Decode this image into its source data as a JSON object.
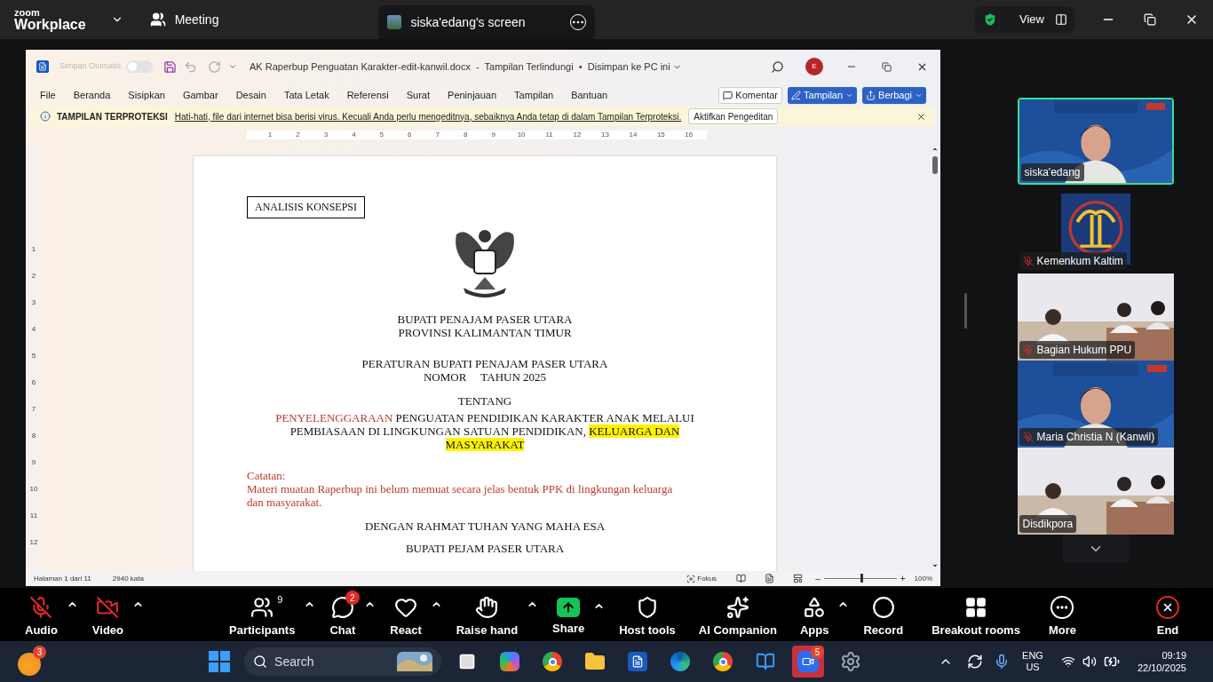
{
  "top_bar": {
    "brand_small": "zoom",
    "brand": "Workplace",
    "tabs": [
      {
        "label": "Meeting",
        "selected": false
      },
      {
        "label": "siska'edang's screen",
        "selected": true
      }
    ],
    "view_button": "View"
  },
  "word": {
    "autosave_label": "Simpan Otomatis",
    "autosave_on": false,
    "title": "AK Raperbup Penguatan Karakter-edit-kanwil.docx  -  Tampilan Terlindungi  •  Disimpan ke PC ini",
    "account_initial": "E",
    "menu": [
      "File",
      "Beranda",
      "Sisipkan",
      "Gambar",
      "Desain",
      "Tata Letak",
      "Referensi",
      "Surat",
      "Peninjauan",
      "Tampilan",
      "Bantuan"
    ],
    "actions": [
      {
        "label": "Komentar",
        "kind": "comment"
      },
      {
        "label": "Tampilan",
        "kind": "view"
      },
      {
        "label": "Berbagi",
        "kind": "share"
      }
    ],
    "protected_view": {
      "label": "TAMPILAN TERPROTEKSI",
      "message": "Hati-hati, file dari internet bisa berisi virus. Kecuali Anda perlu mengeditnya, sebaiknya Anda tetap di dalam Tampilan Terproteksi.",
      "button": "Aktifkan Pengeditan"
    },
    "ruler_numbers": [
      "1",
      "2",
      "3",
      "4",
      "5",
      "6",
      "7",
      "8",
      "9",
      "10",
      "11",
      "12",
      "13",
      "14",
      "15",
      "16"
    ],
    "vertical_ruler_numbers": [
      "1",
      "2",
      "3",
      "4",
      "5",
      "6",
      "7",
      "8",
      "9",
      "10",
      "11",
      "12"
    ],
    "document": {
      "tag": "ANALISIS KONSEPSI",
      "heading_lines": [
        "BUPATI PENAJAM PASER UTARA",
        "PROVINSI KALIMANTAN TIMUR"
      ],
      "regulation_lines": [
        "PERATURAN BUPATI PENAJAM PASER UTARA",
        "NOMOR     TAHUN 2025"
      ],
      "about": "TENTANG",
      "title_segments": [
        {
          "text": "PENYELENGGARAAN",
          "kind": "revision"
        },
        {
          "text": " PENGUATAN PENDIDIKAN KARAKTER ANAK MELALUI PEMBIASAAN DI LINGKUNGAN SATUAN PENDIDIKAN, ",
          "kind": "normal"
        },
        {
          "text": "KELUARGA DAN MASYARAKAT",
          "kind": "marked"
        }
      ],
      "note_label": "Catatan:",
      "note": "Materi muatan Raperbup ini belum memuat secara jelas bentuk PPK di lingkungan keluarga dan masyarakat.",
      "opening": "DENGAN RAHMAT TUHAN YANG MAHA ESA",
      "last_line": "BUPATI PEJAM PASER UTARA"
    },
    "status_bar": {
      "page_info": "Halaman 1 dari 11",
      "word_count": "2940 kata",
      "focus": "Fokus",
      "zoom_out": "–",
      "zoom_in": "+",
      "zoom_level": "100%",
      "zoom_slider": {
        "level": 0.5
      }
    }
  },
  "participants": [
    {
      "name": "siska'edang",
      "kind": "slide",
      "muted": false,
      "speaking": true
    },
    {
      "name": "Kemenkum Kaltim",
      "kind": "logo",
      "muted": true,
      "speaking": false
    },
    {
      "name": "Bagian Hukum PPU",
      "kind": "room",
      "muted": true,
      "speaking": false
    },
    {
      "name": "Maria Christia N (Kanwil)",
      "kind": "slide",
      "muted": true,
      "speaking": false
    },
    {
      "name": "Disdikpora",
      "kind": "room",
      "muted": false,
      "speaking": false
    }
  ],
  "toolbar": [
    {
      "label": "Audio",
      "kind": "audio",
      "off": true,
      "caret": true
    },
    {
      "label": "Video",
      "kind": "video",
      "off": true,
      "caret": true
    },
    {
      "label": "Participants",
      "kind": "participants",
      "count": "9",
      "caret": true
    },
    {
      "label": "Chat",
      "kind": "chat",
      "badge": "2",
      "caret": true
    },
    {
      "label": "React",
      "kind": "react",
      "caret": true
    },
    {
      "label": "Raise hand",
      "kind": "hand",
      "caret": true
    },
    {
      "label": "Share",
      "kind": "share",
      "caret": true
    },
    {
      "label": "Host tools",
      "kind": "host",
      "caret": false
    },
    {
      "label": "AI Companion",
      "kind": "ai",
      "caret": false
    },
    {
      "label": "Apps",
      "kind": "apps",
      "caret": true
    },
    {
      "label": "Record",
      "kind": "record",
      "caret": false
    },
    {
      "label": "Breakout rooms",
      "kind": "breakout",
      "caret": false
    },
    {
      "label": "More",
      "kind": "more",
      "caret": false
    },
    {
      "label": "End",
      "kind": "end",
      "caret": false
    }
  ],
  "taskbar": {
    "weather_badge": "3",
    "search_placeholder": "Search",
    "apps": [
      {
        "kind": "taskview",
        "active": false
      },
      {
        "kind": "copilot",
        "active": false
      },
      {
        "kind": "chrome",
        "active": false
      },
      {
        "kind": "folder",
        "active": false
      },
      {
        "kind": "word",
        "active": false
      },
      {
        "kind": "edge",
        "active": false
      },
      {
        "kind": "chrome",
        "active": false
      },
      {
        "kind": "notepad",
        "active": false
      },
      {
        "kind": "zoom",
        "active": true,
        "badge": "5"
      },
      {
        "kind": "settings",
        "active": false
      }
    ],
    "language": "ENG",
    "region": "US",
    "time": "09:19",
    "date": "22/10/2025"
  }
}
